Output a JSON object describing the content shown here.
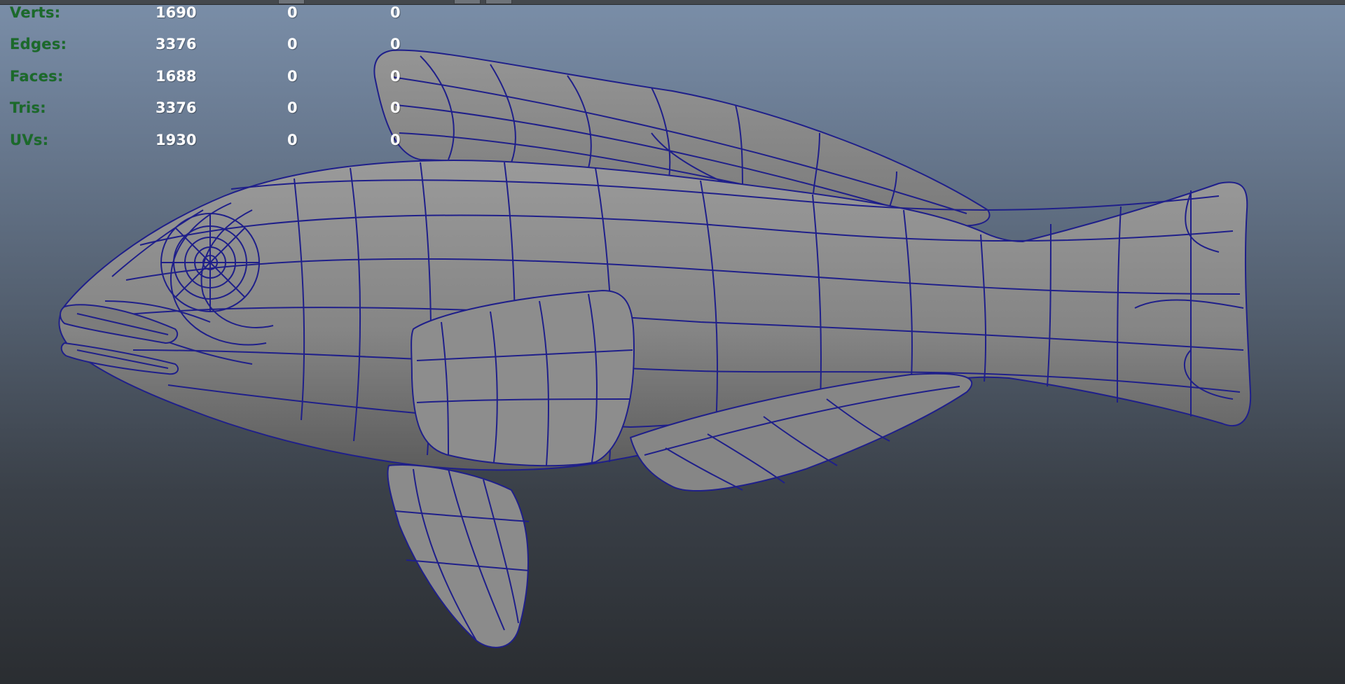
{
  "hud": {
    "rows": [
      {
        "label": "Verts:",
        "values": [
          "1690",
          "0",
          "0"
        ]
      },
      {
        "label": "Edges:",
        "values": [
          "3376",
          "0",
          "0"
        ]
      },
      {
        "label": "Faces:",
        "values": [
          "1688",
          "0",
          "0"
        ]
      },
      {
        "label": "Tris:",
        "values": [
          "3376",
          "0",
          "0"
        ]
      },
      {
        "label": "UVs:",
        "values": [
          "1930",
          "0",
          "0"
        ]
      }
    ]
  },
  "colors": {
    "hud_label": "#1b6a2a",
    "hud_value": "#ffffff",
    "mesh_fill": "#8a8a8a",
    "wireframe": "#1f1f8a",
    "background_top": "#7a8ea8",
    "background_bottom": "#2a2d31"
  },
  "icons": {
    "model": "fish-mesh-icon"
  }
}
